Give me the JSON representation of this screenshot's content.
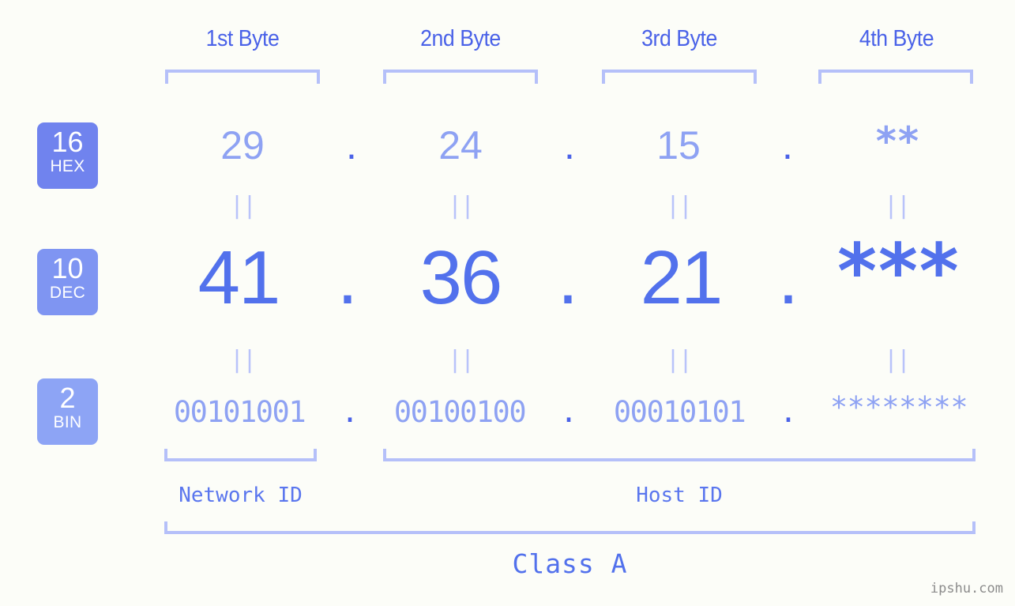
{
  "background_color": "#fcfdf8",
  "accent_colors": {
    "strong_blue": "#4a62e8",
    "mid_blue": "#5271ec",
    "light_blue": "#8ea2f3",
    "bracket_lavender": "#b5c0f9",
    "eq_lavender": "#b9c3fa"
  },
  "byte_headers": [
    {
      "label": "1st Byte"
    },
    {
      "label": "2nd Byte"
    },
    {
      "label": "3rd Byte"
    },
    {
      "label": "4th Byte"
    }
  ],
  "base_badges": [
    {
      "number": "16",
      "name": "HEX",
      "color": "#7083ee"
    },
    {
      "number": "10",
      "name": "DEC",
      "color": "#7f95f2"
    },
    {
      "number": "2",
      "name": "BIN",
      "color": "#8da4f5"
    }
  ],
  "rows": {
    "hex": {
      "base": "16",
      "values": [
        "29",
        "24",
        "15",
        "**"
      ],
      "separator": "."
    },
    "dec": {
      "base": "10",
      "values": [
        "41",
        "36",
        "21",
        "***"
      ],
      "separator": "."
    },
    "bin": {
      "base": "2",
      "values": [
        "00101001",
        "00100100",
        "00010101",
        "********"
      ],
      "separator": "."
    }
  },
  "equality_marks": {
    "symbol": "||",
    "count_per_row": 4
  },
  "id_sections": [
    {
      "label": "Network ID"
    },
    {
      "label": "Host ID"
    }
  ],
  "class_label": "Class A",
  "watermark": "ipshu.com"
}
